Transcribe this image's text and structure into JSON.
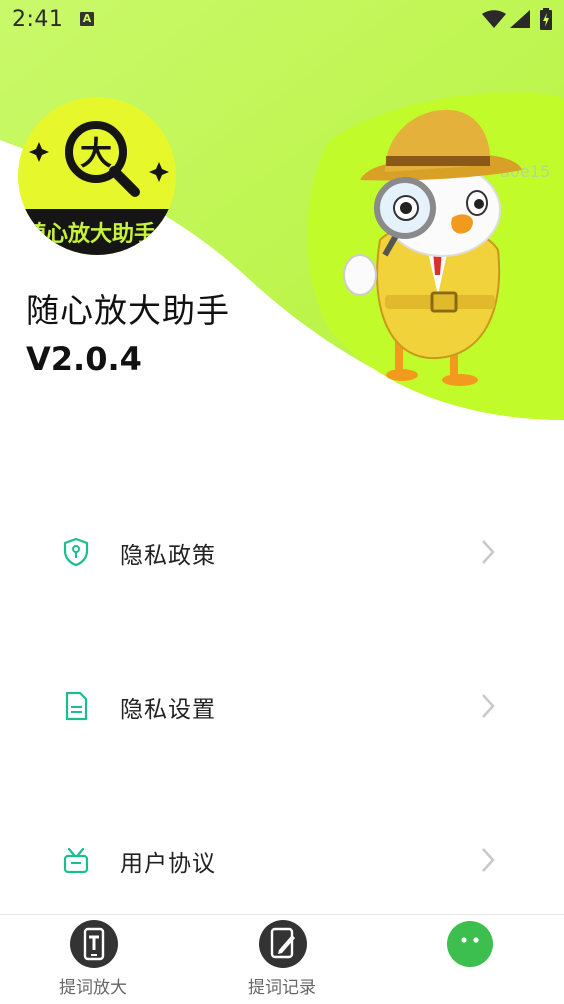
{
  "status_bar": {
    "time": "2:41",
    "notification_icon": "a-badge-icon",
    "wifi_icon": "wifi-icon",
    "signal_icon": "signal-icon",
    "battery_icon": "battery-charging-icon"
  },
  "app": {
    "logo_text": "随心放大助手",
    "logo_glyph": "大",
    "name": "随心放大助手",
    "version": "V2.0.4",
    "watermark": "a0e15"
  },
  "menu": {
    "items": [
      {
        "label": "隐私政策",
        "icon": "shield-icon"
      },
      {
        "label": "隐私设置",
        "icon": "document-icon"
      },
      {
        "label": "用户协议",
        "icon": "gift-box-icon"
      }
    ]
  },
  "bottom_nav": {
    "items": [
      {
        "label": "提词放大",
        "icon": "teleprompter-icon"
      },
      {
        "label": "提词记录",
        "icon": "edit-record-icon"
      },
      {
        "label": "",
        "icon": "chat-face-icon"
      }
    ]
  },
  "colors": {
    "accent_green": "#1bbf8f",
    "lime": "#c2fb3a",
    "logo_yellow": "#e5f72c",
    "nav_active": "#3dbf4f",
    "nav_dark": "#333333"
  }
}
